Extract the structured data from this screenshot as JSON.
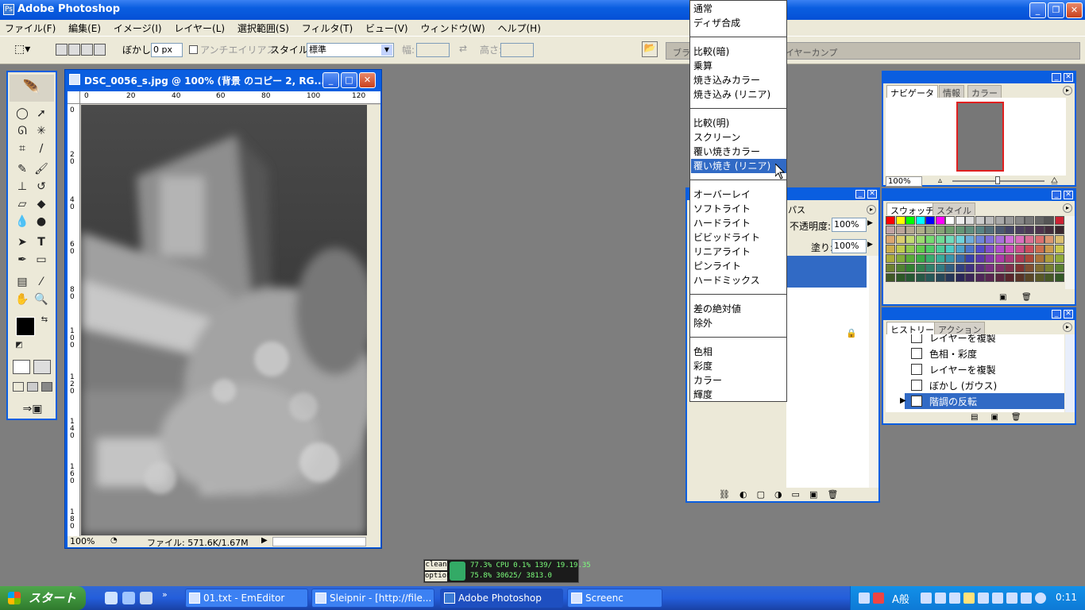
{
  "app": {
    "title": "Adobe Photoshop"
  },
  "menu": [
    "ファイル(F)",
    "編集(E)",
    "イメージ(I)",
    "レイヤー(L)",
    "選択範囲(S)",
    "フィルタ(T)",
    "ビュー(V)",
    "ウィンドウ(W)",
    "ヘルプ(H)"
  ],
  "options": {
    "feather_label": "ぼかし:",
    "feather_value": "0 px",
    "antialias_label": "アンチエイリアス",
    "style_label": "スタイル:",
    "style_value": "標準",
    "width_label": "幅:",
    "height_label": "高さ:",
    "palette_well_tab1": "ブラ",
    "palette_well_tab2": "イヤーカンプ"
  },
  "document": {
    "title": "DSC_0056_s.jpg @ 100% (背景 のコピー 2, RG...",
    "zoom": "100%",
    "file_info": "ファイル: 571.6K/1.67M",
    "ruler_h": [
      "0",
      "20",
      "40",
      "60",
      "80",
      "100",
      "120"
    ],
    "ruler_v": [
      "0",
      "2 0",
      "4 0",
      "6 0",
      "8 0",
      "1 0 0",
      "1 2 0",
      "1 4 0",
      "1 6 0",
      "1 8 0"
    ]
  },
  "blend_menu": {
    "groups": [
      [
        "通常",
        "ディザ合成"
      ],
      [
        "比較(暗)",
        "乗算",
        "焼き込みカラー",
        "焼き込み (リニア)"
      ],
      [
        "比較(明)",
        "スクリーン",
        "覆い焼きカラー",
        "覆い焼き (リニア)"
      ],
      [
        "オーバーレイ",
        "ソフトライト",
        "ハードライト",
        "ビビッドライト",
        "リニアライト",
        "ピンライト",
        "ハードミックス"
      ],
      [
        "差の絶対値",
        "除外"
      ],
      [
        "色相",
        "彩度",
        "カラー",
        "輝度"
      ]
    ],
    "selected": "覆い焼き (リニア)"
  },
  "layers": {
    "tab_partial": "パス",
    "opacity_label": "不透明度:",
    "opacity_value": "100%",
    "fill_label": "塗り:",
    "fill_value": "100%"
  },
  "navigator": {
    "tabs": [
      "ナビゲータ",
      "情報",
      "カラー"
    ],
    "zoom": "100%"
  },
  "swatches": {
    "tabs": [
      "スウォッチ",
      "スタイル"
    ]
  },
  "history": {
    "tabs": [
      "ヒストリー",
      "アクション"
    ],
    "items": [
      "レイヤーを複製",
      "色相・彩度",
      "レイヤーを複製",
      "ぼかし (ガウス)",
      "階調の反転"
    ],
    "selected_index": 4
  },
  "perf": {
    "btn1": "clean",
    "btn2": "option",
    "line1": "77.3% CPU  0.1% 139/ 19.19.35",
    "line2": "75.8%   30625/ 3813.0"
  },
  "taskbar": {
    "start": "スタート",
    "tasks": [
      "01.txt - EmEditor",
      "Sleipnir - [http://file...",
      "Adobe Photoshop",
      "Screenc"
    ],
    "active_index": 2,
    "clock": "0:11",
    "ime": "A般"
  },
  "colors": {
    "title_blue": "#0a5ee0",
    "chrome": "#ece9d8",
    "workspace": "#7e7e7e",
    "selection": "#316ac5"
  }
}
